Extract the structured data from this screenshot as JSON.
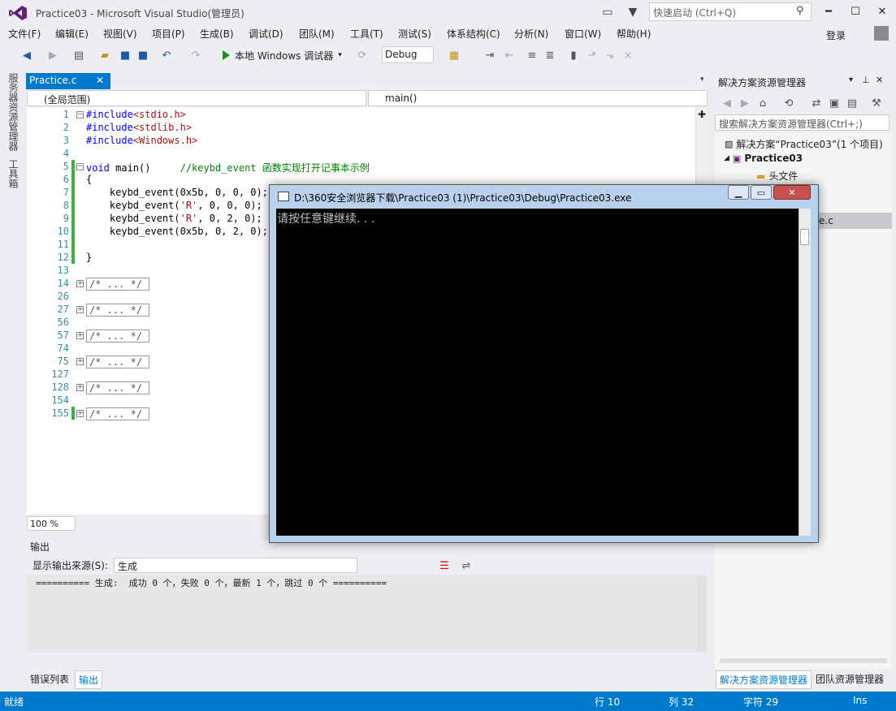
{
  "window": {
    "title": "Practice03 - Microsoft Visual Studio(管理员)",
    "quick_launch_placeholder": "快速启动 (Ctrl+Q)",
    "login": "登录"
  },
  "menu": [
    "文件(F)",
    "编辑(E)",
    "视图(V)",
    "项目(P)",
    "生成(B)",
    "调试(D)",
    "团队(M)",
    "工具(T)",
    "测试(S)",
    "体系结构(C)",
    "分析(N)",
    "窗口(W)",
    "帮助(H)"
  ],
  "toolbar": {
    "run_label": "本地 Windows 调试器",
    "config": "Debug"
  },
  "side_tabs": [
    "服务器资源管理器",
    "工具箱"
  ],
  "editor": {
    "tab_label": "Practice.c",
    "scope": "(全局范围)",
    "function": "main()",
    "zoom": "100 %",
    "lines": [
      {
        "n": "1",
        "code": "#include<stdio.h>"
      },
      {
        "n": "2",
        "code": "#include<stdlib.h>"
      },
      {
        "n": "3",
        "code": "#include<Windows.h>"
      },
      {
        "n": "4",
        "code": ""
      },
      {
        "n": "5",
        "code": "void main()     //keybd_event 函数实现打开记事本示例"
      },
      {
        "n": "6",
        "code": "{"
      },
      {
        "n": "7",
        "code": "    keybd_event(0x5b, 0, 0, 0);"
      },
      {
        "n": "8",
        "code": "    keybd_event('R', 0, 0, 0);"
      },
      {
        "n": "9",
        "code": "    keybd_event('R', 0, 2, 0);"
      },
      {
        "n": "10",
        "code": "    keybd_event(0x5b, 0, 2, 0);"
      },
      {
        "n": "11",
        "code": ""
      },
      {
        "n": "12",
        "code": "}"
      },
      {
        "n": "13",
        "code": ""
      }
    ],
    "folds": [
      {
        "n": "14",
        "label": "/* ... */"
      },
      {
        "n": "26",
        "label": ""
      },
      {
        "n": "27",
        "label": "/* ... */"
      },
      {
        "n": "56",
        "label": ""
      },
      {
        "n": "57",
        "label": "/* ... */"
      },
      {
        "n": "74",
        "label": ""
      },
      {
        "n": "75",
        "label": "/* ... */"
      },
      {
        "n": "127",
        "label": ""
      },
      {
        "n": "128",
        "label": "/* ... */"
      },
      {
        "n": "154",
        "label": ""
      },
      {
        "n": "155",
        "label": "/* ... */"
      }
    ]
  },
  "output": {
    "title": "输出",
    "source_label": "显示输出来源(S):",
    "source_value": "生成",
    "text": "========== 生成:  成功 0 个，失败 0 个，最新 1 个，跳过 0 个 =========="
  },
  "bottom_tabs": [
    "错误列表",
    "输出"
  ],
  "solution_explorer": {
    "title": "解决方案资源管理器",
    "search_placeholder": "搜索解决方案资源管理器(Ctrl+;)",
    "solution": "解决方案“Practice03”(1 个项目)",
    "project": "Practice03",
    "folder": "头文件",
    "file_partial": "e.c",
    "tabs": [
      "解决方案资源管理器",
      "团队资源管理器"
    ]
  },
  "console": {
    "title": "D:\\360安全浏览器下载\\Practice03 (1)\\Practice03\\Debug\\Practice03.exe",
    "text": "请按任意键继续. . ."
  },
  "status": {
    "ready": "就绪",
    "row": "行 10",
    "col": "列 32",
    "char": "字符 29",
    "ins": "Ins"
  },
  "colors": {
    "accent": "#007acc",
    "green": "#3cb043"
  }
}
